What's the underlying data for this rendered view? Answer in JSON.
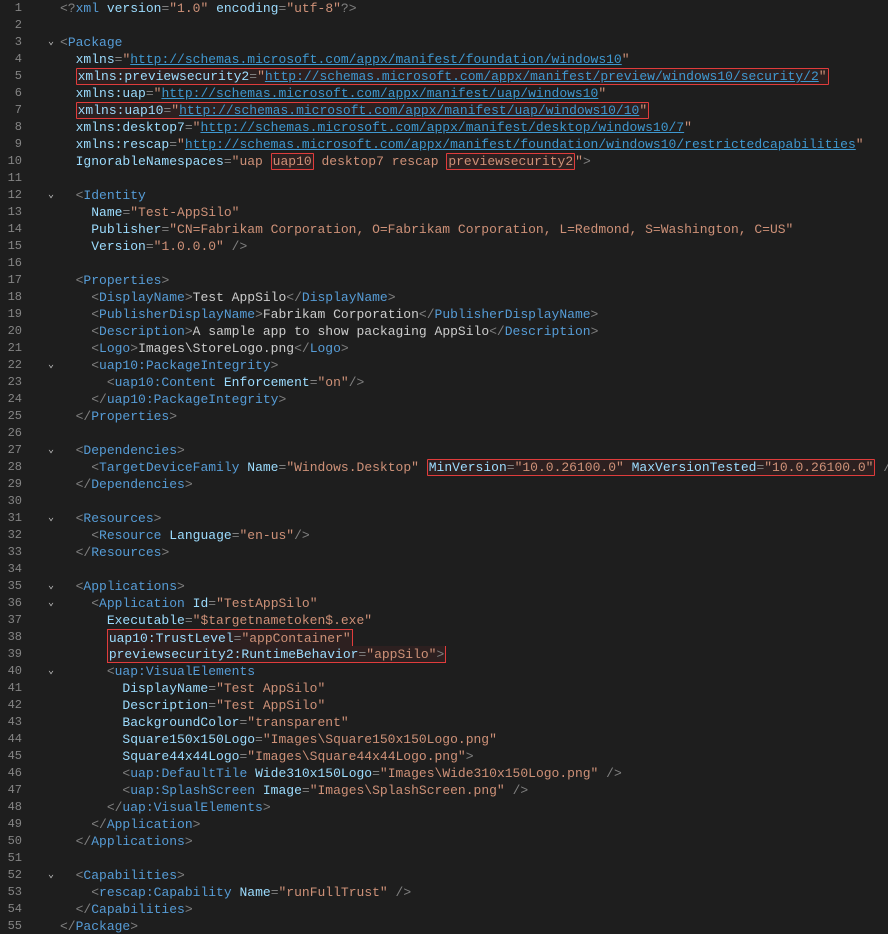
{
  "editor": {
    "line_count": 55,
    "first_line": 1,
    "fold_markers": {
      "3": "v",
      "12": "v",
      "22": "v",
      "27": "v",
      "31": "v",
      "35": "v",
      "36": "v",
      "40": "v",
      "52": "v"
    }
  },
  "highlights": {
    "lines": [
      5,
      7,
      10,
      28,
      38,
      39
    ],
    "note": "line 5 full; line 7 full; line 10 tokens uap10 and previewsecurity2; line 28 MinVersion=.. MaxVersionTested=..; lines 38-39 single box"
  },
  "colors": {
    "background": "#1e1e1e",
    "line_number": "#858585",
    "tag": "#569cd6",
    "attribute": "#9cdcfe",
    "string": "#ce9178",
    "url": "#3f98d0",
    "highlight_border": "#e03c3c"
  },
  "xml": {
    "declaration": {
      "version": "1.0",
      "encoding": "utf-8"
    },
    "Package": {
      "attributes": {
        "xmlns": "http://schemas.microsoft.com/appx/manifest/foundation/windows10",
        "xmlns:previewsecurity2": "http://schemas.microsoft.com/appx/manifest/preview/windows10/security/2",
        "xmlns:uap": "http://schemas.microsoft.com/appx/manifest/uap/windows10",
        "xmlns:uap10": "http://schemas.microsoft.com/appx/manifest/uap/windows10/10",
        "xmlns:desktop7": "http://schemas.microsoft.com/appx/manifest/desktop/windows10/7",
        "xmlns:rescap": "http://schemas.microsoft.com/appx/manifest/foundation/windows10/restrictedcapabilities",
        "IgnorableNamespaces": "uap uap10 desktop7 rescap previewsecurity2"
      },
      "Identity": {
        "Name": "Test-AppSilo",
        "Publisher": "CN=Fabrikam Corporation, O=Fabrikam Corporation, L=Redmond, S=Washington, C=US",
        "Version": "1.0.0.0"
      },
      "Properties": {
        "DisplayName": "Test AppSilo",
        "PublisherDisplayName": "Fabrikam Corporation",
        "Description": "A sample app to show packaging AppSilo",
        "Logo": "Images\\StoreLogo.png",
        "uap10:PackageIntegrity": {
          "uap10:Content": {
            "Enforcement": "on"
          }
        }
      },
      "Dependencies": {
        "TargetDeviceFamily": {
          "Name": "Windows.Desktop",
          "MinVersion": "10.0.26100.0",
          "MaxVersionTested": "10.0.26100.0"
        }
      },
      "Resources": {
        "Resource": {
          "Language": "en-us"
        }
      },
      "Applications": {
        "Application": {
          "Id": "TestAppSilo",
          "Executable": "$targetnametoken$.exe",
          "uap10:TrustLevel": "appContainer",
          "previewsecurity2:RuntimeBehavior": "appSilo",
          "uap:VisualElements": {
            "DisplayName": "Test AppSilo",
            "Description": "Test AppSilo",
            "BackgroundColor": "transparent",
            "Square150x150Logo": "Images\\Square150x150Logo.png",
            "Square44x44Logo": "Images\\Square44x44Logo.png",
            "uap:DefaultTile": {
              "Wide310x150Logo": "Images\\Wide310x150Logo.png"
            },
            "uap:SplashScreen": {
              "Image": "Images\\SplashScreen.png"
            }
          }
        }
      },
      "Capabilities": {
        "rescap:Capability": {
          "Name": "runFullTrust"
        }
      }
    }
  },
  "token_lines": [
    [
      [
        "punct",
        "<?"
      ],
      [
        "tag",
        "xml "
      ],
      [
        "attr",
        "version"
      ],
      [
        "punct",
        "="
      ],
      [
        "str",
        "\"1.0\""
      ],
      [
        "txt",
        " "
      ],
      [
        "attr",
        "encoding"
      ],
      [
        "punct",
        "="
      ],
      [
        "str",
        "\"utf-8\""
      ],
      [
        "punct",
        "?>"
      ]
    ],
    [],
    [
      [
        "punct",
        "<"
      ],
      [
        "tag",
        "Package"
      ]
    ],
    [
      [
        "txt",
        "  "
      ],
      [
        "attr",
        "xmlns"
      ],
      [
        "punct",
        "="
      ],
      [
        "str",
        "\""
      ],
      [
        "url",
        "http://schemas.microsoft.com/appx/manifest/foundation/windows10"
      ],
      [
        "str",
        "\""
      ]
    ],
    [
      [
        "txt",
        "  "
      ],
      [
        "boxstart",
        ""
      ],
      [
        "attr",
        "xmlns:previewsecurity2"
      ],
      [
        "punct",
        "="
      ],
      [
        "str",
        "\""
      ],
      [
        "url",
        "http://schemas.microsoft.com/appx/manifest/preview/windows10/security/2"
      ],
      [
        "str",
        "\""
      ],
      [
        "boxend",
        ""
      ]
    ],
    [
      [
        "txt",
        "  "
      ],
      [
        "attr",
        "xmlns:uap"
      ],
      [
        "punct",
        "="
      ],
      [
        "str",
        "\""
      ],
      [
        "url",
        "http://schemas.microsoft.com/appx/manifest/uap/windows10"
      ],
      [
        "str",
        "\""
      ]
    ],
    [
      [
        "txt",
        "  "
      ],
      [
        "boxstart",
        ""
      ],
      [
        "attr",
        "xmlns:uap10"
      ],
      [
        "punct",
        "="
      ],
      [
        "str",
        "\""
      ],
      [
        "url",
        "http://schemas.microsoft.com/appx/manifest/uap/windows10/10"
      ],
      [
        "str",
        "\""
      ],
      [
        "boxend",
        ""
      ]
    ],
    [
      [
        "txt",
        "  "
      ],
      [
        "attr",
        "xmlns:desktop7"
      ],
      [
        "punct",
        "="
      ],
      [
        "str",
        "\""
      ],
      [
        "url",
        "http://schemas.microsoft.com/appx/manifest/desktop/windows10/7"
      ],
      [
        "str",
        "\""
      ]
    ],
    [
      [
        "txt",
        "  "
      ],
      [
        "attr",
        "xmlns:rescap"
      ],
      [
        "punct",
        "="
      ],
      [
        "str",
        "\""
      ],
      [
        "url",
        "http://schemas.microsoft.com/appx/manifest/foundation/windows10/restrictedcapabilities"
      ],
      [
        "str",
        "\""
      ]
    ],
    [
      [
        "txt",
        "  "
      ],
      [
        "attr",
        "IgnorableNamespaces"
      ],
      [
        "punct",
        "="
      ],
      [
        "str",
        "\"uap "
      ],
      [
        "boxstart",
        ""
      ],
      [
        "str",
        "uap10"
      ],
      [
        "boxend",
        ""
      ],
      [
        "str",
        " desktop7 rescap "
      ],
      [
        "boxstart",
        ""
      ],
      [
        "str",
        "previewsecurity2"
      ],
      [
        "boxend",
        ""
      ],
      [
        "str",
        "\""
      ],
      [
        "punct",
        ">"
      ]
    ],
    [],
    [
      [
        "txt",
        "  "
      ],
      [
        "punct",
        "<"
      ],
      [
        "tag",
        "Identity"
      ]
    ],
    [
      [
        "txt",
        "    "
      ],
      [
        "attr",
        "Name"
      ],
      [
        "punct",
        "="
      ],
      [
        "str",
        "\"Test-AppSilo\""
      ]
    ],
    [
      [
        "txt",
        "    "
      ],
      [
        "attr",
        "Publisher"
      ],
      [
        "punct",
        "="
      ],
      [
        "str",
        "\"CN=Fabrikam Corporation, O=Fabrikam Corporation, L=Redmond, S=Washington, C=US\""
      ]
    ],
    [
      [
        "txt",
        "    "
      ],
      [
        "attr",
        "Version"
      ],
      [
        "punct",
        "="
      ],
      [
        "str",
        "\"1.0.0.0\""
      ],
      [
        "txt",
        " "
      ],
      [
        "punct",
        "/>"
      ]
    ],
    [],
    [
      [
        "txt",
        "  "
      ],
      [
        "punct",
        "<"
      ],
      [
        "tag",
        "Properties"
      ],
      [
        "punct",
        ">"
      ]
    ],
    [
      [
        "txt",
        "    "
      ],
      [
        "punct",
        "<"
      ],
      [
        "tag",
        "DisplayName"
      ],
      [
        "punct",
        ">"
      ],
      [
        "txt",
        "Test AppSilo"
      ],
      [
        "punct",
        "</"
      ],
      [
        "tag",
        "DisplayName"
      ],
      [
        "punct",
        ">"
      ]
    ],
    [
      [
        "txt",
        "    "
      ],
      [
        "punct",
        "<"
      ],
      [
        "tag",
        "PublisherDisplayName"
      ],
      [
        "punct",
        ">"
      ],
      [
        "txt",
        "Fabrikam Corporation"
      ],
      [
        "punct",
        "</"
      ],
      [
        "tag",
        "PublisherDisplayName"
      ],
      [
        "punct",
        ">"
      ]
    ],
    [
      [
        "txt",
        "    "
      ],
      [
        "punct",
        "<"
      ],
      [
        "tag",
        "Description"
      ],
      [
        "punct",
        ">"
      ],
      [
        "txt",
        "A sample app to show packaging AppSilo"
      ],
      [
        "punct",
        "</"
      ],
      [
        "tag",
        "Description"
      ],
      [
        "punct",
        ">"
      ]
    ],
    [
      [
        "txt",
        "    "
      ],
      [
        "punct",
        "<"
      ],
      [
        "tag",
        "Logo"
      ],
      [
        "punct",
        ">"
      ],
      [
        "txt",
        "Images\\StoreLogo.png"
      ],
      [
        "punct",
        "</"
      ],
      [
        "tag",
        "Logo"
      ],
      [
        "punct",
        ">"
      ]
    ],
    [
      [
        "txt",
        "    "
      ],
      [
        "punct",
        "<"
      ],
      [
        "tag",
        "uap10:PackageIntegrity"
      ],
      [
        "punct",
        ">"
      ]
    ],
    [
      [
        "txt",
        "      "
      ],
      [
        "punct",
        "<"
      ],
      [
        "tag",
        "uap10:Content"
      ],
      [
        "txt",
        " "
      ],
      [
        "attr",
        "Enforcement"
      ],
      [
        "punct",
        "="
      ],
      [
        "str",
        "\"on\""
      ],
      [
        "punct",
        "/>"
      ]
    ],
    [
      [
        "txt",
        "    "
      ],
      [
        "punct",
        "</"
      ],
      [
        "tag",
        "uap10:PackageIntegrity"
      ],
      [
        "punct",
        ">"
      ]
    ],
    [
      [
        "txt",
        "  "
      ],
      [
        "punct",
        "</"
      ],
      [
        "tag",
        "Properties"
      ],
      [
        "punct",
        ">"
      ]
    ],
    [],
    [
      [
        "txt",
        "  "
      ],
      [
        "punct",
        "<"
      ],
      [
        "tag",
        "Dependencies"
      ],
      [
        "punct",
        ">"
      ]
    ],
    [
      [
        "txt",
        "    "
      ],
      [
        "punct",
        "<"
      ],
      [
        "tag",
        "TargetDeviceFamily"
      ],
      [
        "txt",
        " "
      ],
      [
        "attr",
        "Name"
      ],
      [
        "punct",
        "="
      ],
      [
        "str",
        "\"Windows.Desktop\""
      ],
      [
        "txt",
        " "
      ],
      [
        "boxstart",
        ""
      ],
      [
        "attr",
        "MinVersion"
      ],
      [
        "punct",
        "="
      ],
      [
        "str",
        "\"10.0.26100.0\""
      ],
      [
        "txt",
        " "
      ],
      [
        "attr",
        "MaxVersionTested"
      ],
      [
        "punct",
        "="
      ],
      [
        "str",
        "\"10.0.26100.0\""
      ],
      [
        "boxend",
        ""
      ],
      [
        "txt",
        " "
      ],
      [
        "punct",
        "/>"
      ]
    ],
    [
      [
        "txt",
        "  "
      ],
      [
        "punct",
        "</"
      ],
      [
        "tag",
        "Dependencies"
      ],
      [
        "punct",
        ">"
      ]
    ],
    [],
    [
      [
        "txt",
        "  "
      ],
      [
        "punct",
        "<"
      ],
      [
        "tag",
        "Resources"
      ],
      [
        "punct",
        ">"
      ]
    ],
    [
      [
        "txt",
        "    "
      ],
      [
        "punct",
        "<"
      ],
      [
        "tag",
        "Resource"
      ],
      [
        "txt",
        " "
      ],
      [
        "attr",
        "Language"
      ],
      [
        "punct",
        "="
      ],
      [
        "str",
        "\"en-us\""
      ],
      [
        "punct",
        "/>"
      ]
    ],
    [
      [
        "txt",
        "  "
      ],
      [
        "punct",
        "</"
      ],
      [
        "tag",
        "Resources"
      ],
      [
        "punct",
        ">"
      ]
    ],
    [],
    [
      [
        "txt",
        "  "
      ],
      [
        "punct",
        "<"
      ],
      [
        "tag",
        "Applications"
      ],
      [
        "punct",
        ">"
      ]
    ],
    [
      [
        "txt",
        "    "
      ],
      [
        "punct",
        "<"
      ],
      [
        "tag",
        "Application"
      ],
      [
        "txt",
        " "
      ],
      [
        "attr",
        "Id"
      ],
      [
        "punct",
        "="
      ],
      [
        "str",
        "\"TestAppSilo\""
      ]
    ],
    [
      [
        "txt",
        "      "
      ],
      [
        "attr",
        "Executable"
      ],
      [
        "punct",
        "="
      ],
      [
        "str",
        "\"$targetnametoken$.exe\""
      ]
    ],
    [
      [
        "txt",
        "      "
      ],
      [
        "multiboxstart",
        ""
      ],
      [
        "attr",
        "uap10:TrustLevel"
      ],
      [
        "punct",
        "="
      ],
      [
        "str",
        "\"appContainer\""
      ]
    ],
    [
      [
        "txt",
        "      "
      ],
      [
        "attr",
        "previewsecurity2:RuntimeBehavior"
      ],
      [
        "punct",
        "="
      ],
      [
        "str",
        "\"appSilo\""
      ],
      [
        "punct",
        ">"
      ],
      [
        "multiboxend",
        ""
      ]
    ],
    [
      [
        "txt",
        "      "
      ],
      [
        "punct",
        "<"
      ],
      [
        "tag",
        "uap:VisualElements"
      ]
    ],
    [
      [
        "txt",
        "        "
      ],
      [
        "attr",
        "DisplayName"
      ],
      [
        "punct",
        "="
      ],
      [
        "str",
        "\"Test AppSilo\""
      ]
    ],
    [
      [
        "txt",
        "        "
      ],
      [
        "attr",
        "Description"
      ],
      [
        "punct",
        "="
      ],
      [
        "str",
        "\"Test AppSilo\""
      ]
    ],
    [
      [
        "txt",
        "        "
      ],
      [
        "attr",
        "BackgroundColor"
      ],
      [
        "punct",
        "="
      ],
      [
        "str",
        "\"transparent\""
      ]
    ],
    [
      [
        "txt",
        "        "
      ],
      [
        "attr",
        "Square150x150Logo"
      ],
      [
        "punct",
        "="
      ],
      [
        "str",
        "\"Images\\Square150x150Logo.png\""
      ]
    ],
    [
      [
        "txt",
        "        "
      ],
      [
        "attr",
        "Square44x44Logo"
      ],
      [
        "punct",
        "="
      ],
      [
        "str",
        "\"Images\\Square44x44Logo.png\""
      ],
      [
        "punct",
        ">"
      ]
    ],
    [
      [
        "txt",
        "        "
      ],
      [
        "punct",
        "<"
      ],
      [
        "tag",
        "uap:DefaultTile"
      ],
      [
        "txt",
        " "
      ],
      [
        "attr",
        "Wide310x150Logo"
      ],
      [
        "punct",
        "="
      ],
      [
        "str",
        "\"Images\\Wide310x150Logo.png\""
      ],
      [
        "txt",
        " "
      ],
      [
        "punct",
        "/>"
      ]
    ],
    [
      [
        "txt",
        "        "
      ],
      [
        "punct",
        "<"
      ],
      [
        "tag",
        "uap:SplashScreen"
      ],
      [
        "txt",
        " "
      ],
      [
        "attr",
        "Image"
      ],
      [
        "punct",
        "="
      ],
      [
        "str",
        "\"Images\\SplashScreen.png\""
      ],
      [
        "txt",
        " "
      ],
      [
        "punct",
        "/>"
      ]
    ],
    [
      [
        "txt",
        "      "
      ],
      [
        "punct",
        "</"
      ],
      [
        "tag",
        "uap:VisualElements"
      ],
      [
        "punct",
        ">"
      ]
    ],
    [
      [
        "txt",
        "    "
      ],
      [
        "punct",
        "</"
      ],
      [
        "tag",
        "Application"
      ],
      [
        "punct",
        ">"
      ]
    ],
    [
      [
        "txt",
        "  "
      ],
      [
        "punct",
        "</"
      ],
      [
        "tag",
        "Applications"
      ],
      [
        "punct",
        ">"
      ]
    ],
    [],
    [
      [
        "txt",
        "  "
      ],
      [
        "punct",
        "<"
      ],
      [
        "tag",
        "Capabilities"
      ],
      [
        "punct",
        ">"
      ]
    ],
    [
      [
        "txt",
        "    "
      ],
      [
        "punct",
        "<"
      ],
      [
        "tag",
        "rescap:Capability"
      ],
      [
        "txt",
        " "
      ],
      [
        "attr",
        "Name"
      ],
      [
        "punct",
        "="
      ],
      [
        "str",
        "\"runFullTrust\""
      ],
      [
        "txt",
        " "
      ],
      [
        "punct",
        "/>"
      ]
    ],
    [
      [
        "txt",
        "  "
      ],
      [
        "punct",
        "</"
      ],
      [
        "tag",
        "Capabilities"
      ],
      [
        "punct",
        ">"
      ]
    ],
    [
      [
        "punct",
        "</"
      ],
      [
        "tag",
        "Package"
      ],
      [
        "punct",
        ">"
      ]
    ]
  ]
}
